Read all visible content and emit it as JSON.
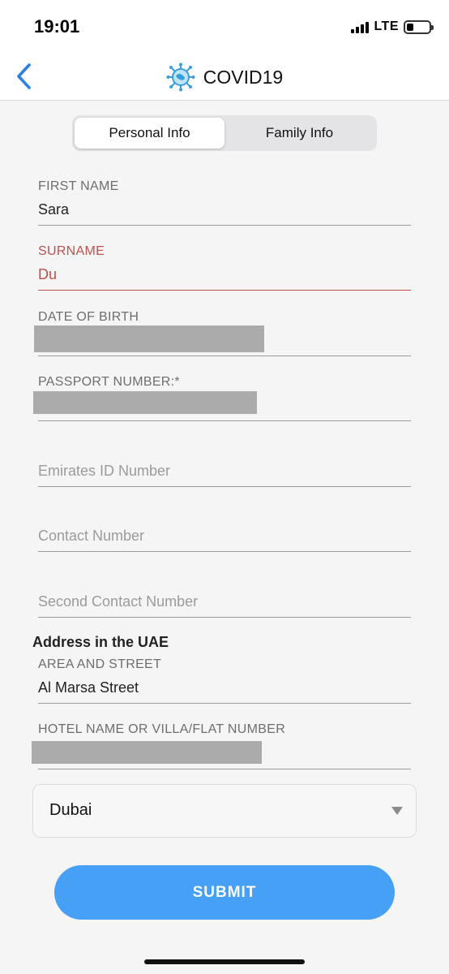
{
  "status_bar": {
    "time": "19:01",
    "network": "LTE",
    "battery_level": 0.3
  },
  "nav": {
    "title": "COVID19",
    "back_icon": "chevron-left-icon",
    "logo_icon": "virus-icon",
    "accent_color": "#2f7fe0"
  },
  "tabs": [
    {
      "label": "Personal Info",
      "active": true
    },
    {
      "label": "Family Info",
      "active": false
    }
  ],
  "form": {
    "first_name": {
      "label": "FIRST NAME",
      "value": "Sara"
    },
    "surname": {
      "label": "SURNAME",
      "value": "Du",
      "error_color": "#c0504d"
    },
    "date_of_birth": {
      "label": "DATE OF BIRTH",
      "value": ""
    },
    "passport_number": {
      "label": "PASSPORT NUMBER:*",
      "value": ""
    },
    "emirates_id": {
      "placeholder": "Emirates ID Number"
    },
    "contact_number": {
      "placeholder": "Contact Number"
    },
    "second_contact": {
      "placeholder": "Second Contact Number"
    },
    "address_section_title": "Address in the UAE",
    "area_street": {
      "label": "AREA AND STREET",
      "value": "Al Marsa Street"
    },
    "hotel_villa": {
      "label": "HOTEL NAME OR VILLA/FLAT NUMBER",
      "value": ""
    },
    "emirate_select": {
      "value": "Dubai"
    },
    "submit_label": "SUBMIT",
    "submit_color": "#46a0f5"
  }
}
